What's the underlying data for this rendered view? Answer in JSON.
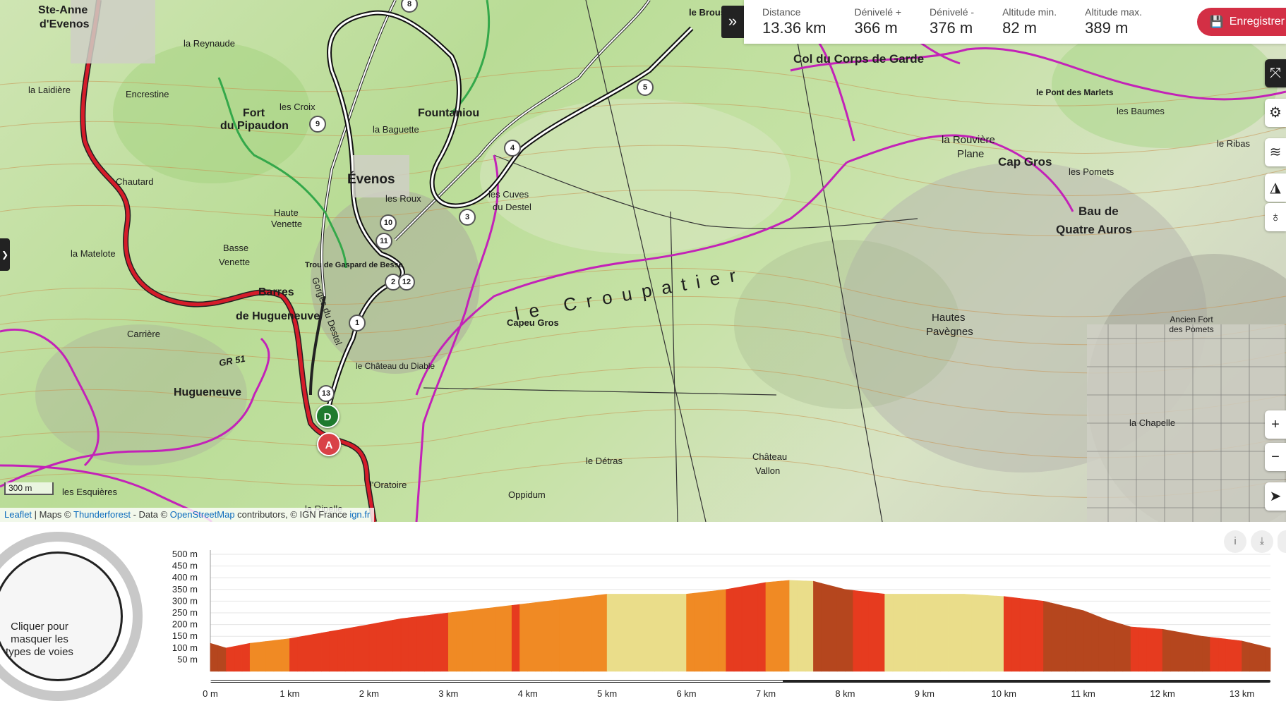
{
  "stats": [
    {
      "label": "Distance",
      "value": "13.36 km"
    },
    {
      "label": "Dénivelé +",
      "value": "366 m"
    },
    {
      "label": "Dénivelé -",
      "value": "376 m"
    },
    {
      "label": "Altitude min.",
      "value": "82 m"
    },
    {
      "label": "Altitude max.",
      "value": "389 m"
    }
  ],
  "save_label": "Enregistrer",
  "collapse_icon": "»",
  "map": {
    "places": [
      {
        "text": "Ste-Anne"
      },
      {
        "text": "d'Evenos"
      },
      {
        "text": "la Reynaude"
      },
      {
        "text": "Fort"
      },
      {
        "text": "du Pipaudon"
      },
      {
        "text": "Évenos"
      },
      {
        "text": "Fountaniou"
      },
      {
        "text": "la Baguette"
      },
      {
        "text": "les Croix"
      },
      {
        "text": "Chautard"
      },
      {
        "text": "Haute"
      },
      {
        "text": "Venette"
      },
      {
        "text": "Basse"
      },
      {
        "text": "Venette"
      },
      {
        "text": "la Matelote"
      },
      {
        "text": "Barres"
      },
      {
        "text": "de Huguenеuve"
      },
      {
        "text": "Hugueneuve"
      },
      {
        "text": "Carrière"
      },
      {
        "text": "les Cuves"
      },
      {
        "text": "du Destel"
      },
      {
        "text": "Capeu Gros"
      },
      {
        "text": "le Croupatier"
      },
      {
        "text": "Col du Corps de Garde"
      },
      {
        "text": "la Rouvière"
      },
      {
        "text": "Plane"
      },
      {
        "text": "Cap Gros"
      },
      {
        "text": "Bau de"
      },
      {
        "text": "Quatre Auros"
      },
      {
        "text": "Hautes"
      },
      {
        "text": "Pavègnes"
      },
      {
        "text": "Château"
      },
      {
        "text": "Vallon"
      },
      {
        "text": "le Détras"
      },
      {
        "text": "l'Oratoire"
      },
      {
        "text": "la Ripelle"
      },
      {
        "text": "les Esquières"
      },
      {
        "text": "Oppidum"
      },
      {
        "text": "la Chapelle"
      },
      {
        "text": "les Pomets"
      },
      {
        "text": "le Broussan"
      },
      {
        "text": "la Laidière"
      },
      {
        "text": "Encrestine"
      },
      {
        "text": "Gorges du Destel"
      },
      {
        "text": "le Château du Diable"
      },
      {
        "text": "Trou de Gaspard de Besse"
      },
      {
        "text": "GR 51"
      },
      {
        "text": "les Roux"
      },
      {
        "text": "Ancien Fort des Pomets"
      },
      {
        "text": "le Pont des Marlets"
      },
      {
        "text": "les Baumes"
      },
      {
        "text": "le Ribas"
      }
    ],
    "waypoints": [
      "1",
      "2",
      "3",
      "4",
      "5",
      "8",
      "9",
      "10",
      "11",
      "12",
      "13"
    ],
    "start_label": "D",
    "end_label": "A",
    "scale_label": "300 m",
    "attribution": {
      "leaflet": "Leaflet",
      "maps_prefix": " | Maps © ",
      "thunderforest": "Thunderforest",
      "data_prefix": " - Data © ",
      "osm": "OpenStreetMap",
      "contrib": " contributors, © IGN France ",
      "ign": "ign.fr"
    }
  },
  "profile": {
    "toggle_text": "Cliquer pour masquer les types de voies"
  },
  "chart_data": {
    "type": "area",
    "ylabel": "",
    "xlabel": "",
    "x_ticks": [
      "0 m",
      "1 km",
      "2 km",
      "3 km",
      "4 km",
      "5 km",
      "6 km",
      "7 km",
      "8 km",
      "9 km",
      "10 km",
      "11 km",
      "12 km",
      "13 km"
    ],
    "y_ticks": [
      "50 m",
      "100 m",
      "150 m",
      "200 m",
      "250 m",
      "300 m",
      "350 m",
      "400 m",
      "450 m",
      "500 m"
    ],
    "ylim": [
      0,
      500
    ],
    "xlim": [
      0,
      13.36
    ],
    "x": [
      0,
      0.2,
      0.5,
      1.0,
      1.5,
      2.0,
      2.4,
      3.0,
      3.5,
      4.0,
      4.5,
      5.0,
      5.5,
      6.0,
      6.5,
      7.0,
      7.3,
      7.6,
      8.0,
      8.5,
      9.0,
      9.5,
      10.0,
      10.5,
      11.0,
      11.3,
      11.6,
      12.0,
      12.5,
      13.0,
      13.36
    ],
    "y": [
      120,
      100,
      120,
      140,
      170,
      200,
      225,
      250,
      270,
      290,
      310,
      330,
      330,
      330,
      350,
      380,
      389,
      385,
      350,
      330,
      330,
      330,
      320,
      300,
      260,
      220,
      190,
      180,
      150,
      130,
      100
    ],
    "surface_colors": [
      "#eadd8a",
      "#f5c242",
      "#f08a24",
      "#e63b1f",
      "#b5461e"
    ]
  },
  "colors": {
    "route": "#d51c2a",
    "trail": "#c322b8",
    "save": "#d32f45"
  }
}
